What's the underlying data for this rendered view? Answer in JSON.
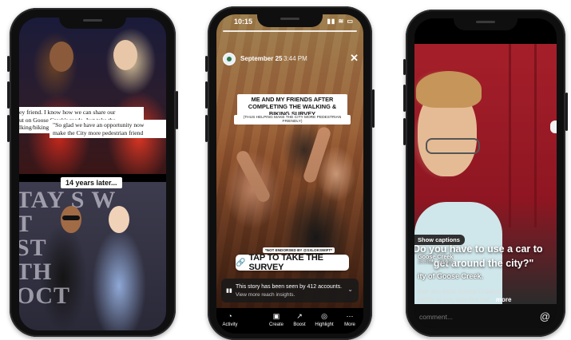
{
  "phone1": {
    "caption_top": "ey friend. I know how we can share our\nut on Goose Creek's roads. Just take the\nlking/biking survey. It closes on Nov 3.\"",
    "divider_label": "14 years later...",
    "bg_text": "TAY  S W\nT\nST\nTH\nOCT",
    "caption_bottom": "\"So glad we have an opportunity now\nmake the City more pedestrian friend"
  },
  "phone2": {
    "status_time": "10:15",
    "status_icons": "▮▮ ≋ ▭",
    "date": "September 25",
    "time": "3:44 PM",
    "close_icon": "✕",
    "title": "ME AND MY FRIENDS AFTER COMPLETING THE WALKING & BIKING SURVEY",
    "subtitle": "(THUS HELPING MAKE THE CITY MORE PEDESTRIAN FRIENDLY)",
    "disclaimer": "*NOT ENDORSED BY @SXLOKSWIFT*",
    "cta_icon": "🔗",
    "cta_text": "TAP TO TAKE THE SURVEY",
    "reach_line1": "This story has been seen by 412 accounts.",
    "reach_line2": "View more reach insights.",
    "reach_chevron": "⌄",
    "toolbar": [
      {
        "icon": "◔",
        "label": "Activity"
      },
      {
        "icon": "▣",
        "label": "Create"
      },
      {
        "icon": "↗",
        "label": "Boost"
      },
      {
        "icon": "◎",
        "label": "Highlight"
      },
      {
        "icon": "⋯",
        "label": "More"
      }
    ]
  },
  "phone3": {
    "caption_pill": "Show captions",
    "overlay_title_1": "Do you have to use a car to",
    "overlay_title_2": "\"get around the city?\"",
    "account": "Goose Creek",
    "meta": "15,682 ... 5d ago",
    "place": "ity of Goose Creek.",
    "description": "ther you think Goose Creek is",
    "description_2": "ssible or not, take the sur...",
    "more_label": "more",
    "comment_placeholder": "comment...",
    "at_icon": "@"
  }
}
